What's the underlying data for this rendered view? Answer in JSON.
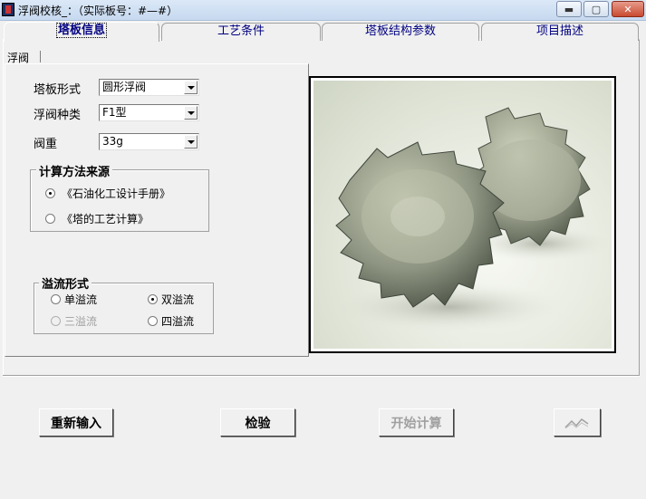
{
  "window": {
    "title": "浮阀校核_：（实际板号：#—#）",
    "buttons": {
      "minimize": "▬",
      "maximize": "▢",
      "close": "✕"
    }
  },
  "tabs": [
    {
      "label": "塔板信息",
      "active": true
    },
    {
      "label": "工艺条件",
      "active": false
    },
    {
      "label": "塔板结构参数",
      "active": false
    },
    {
      "label": "项目描述",
      "active": false
    }
  ],
  "inner_tab": {
    "label": "浮阀"
  },
  "form": {
    "tray_type": {
      "label": "塔板形式",
      "value": "圆形浮阀"
    },
    "valve_type": {
      "label": "浮阀种类",
      "value": "F1型"
    },
    "valve_weight": {
      "label": "阀重",
      "value": "33g"
    }
  },
  "calc_source": {
    "title": "计算方法来源",
    "options": [
      {
        "label": "《石油化工设计手册》",
        "checked": true
      },
      {
        "label": "《塔的工艺计算》",
        "checked": false
      }
    ]
  },
  "overflow": {
    "title": "溢流形式",
    "options": [
      {
        "label": "单溢流",
        "checked": false,
        "enabled": true
      },
      {
        "label": "双溢流",
        "checked": true,
        "enabled": true
      },
      {
        "label": "三溢流",
        "checked": false,
        "enabled": false
      },
      {
        "label": "四溢流",
        "checked": false,
        "enabled": true
      }
    ]
  },
  "buttons": {
    "reset": "重新输入",
    "check": "检验",
    "start": "开始计算"
  },
  "icons": {
    "chart_button": "chart-icon",
    "app": "app-icon"
  }
}
